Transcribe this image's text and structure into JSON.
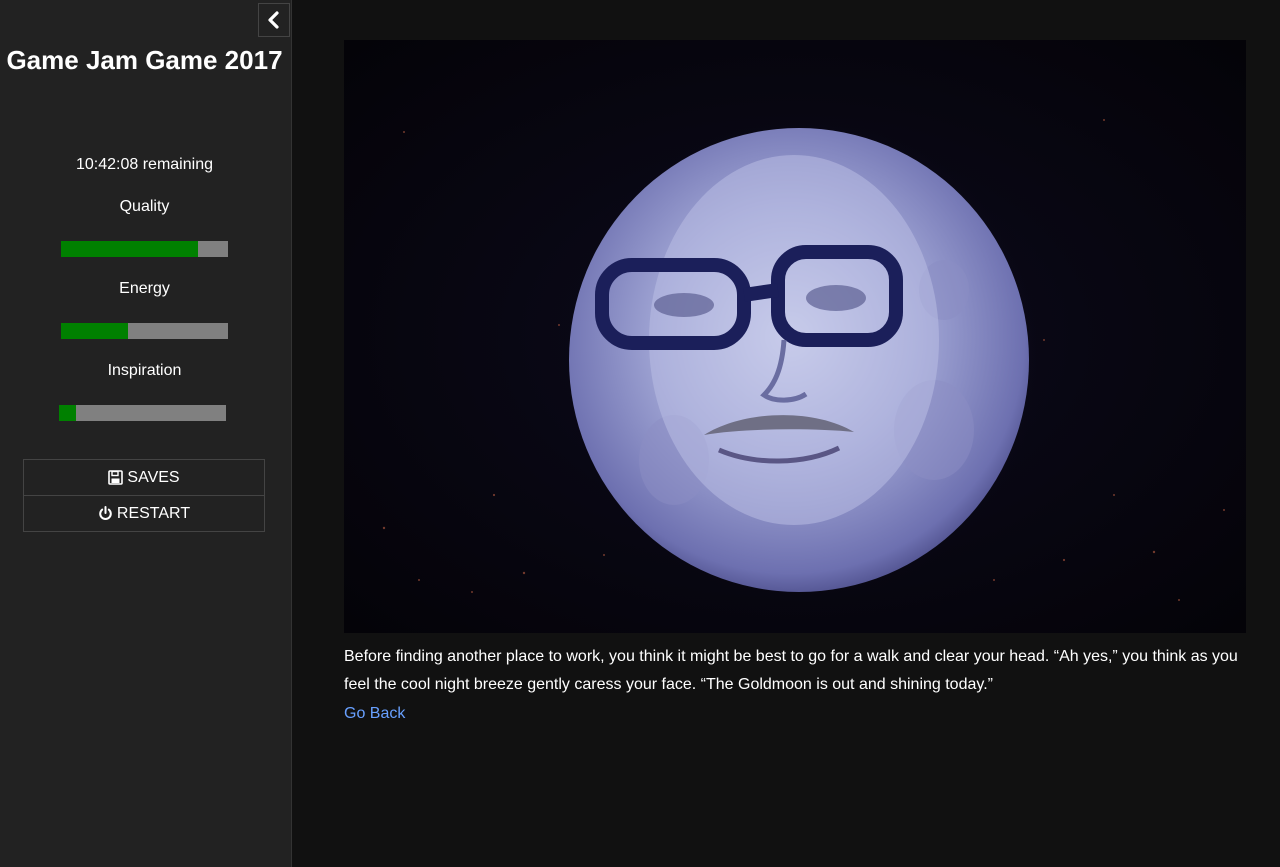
{
  "sidebar": {
    "toggle_icon": "chevron-left-icon",
    "title": "Game Jam Game 2017",
    "timer": "10:42:08 remaining",
    "stats": [
      {
        "label": "Quality",
        "value": 0.82
      },
      {
        "label": "Energy",
        "value": 0.4
      },
      {
        "label": "Inspiration",
        "value": 0.1
      }
    ],
    "menu": {
      "saves_label": "SAVES",
      "saves_icon": "floppy-disk-icon",
      "restart_label": "RESTART",
      "restart_icon": "power-icon"
    }
  },
  "passage": {
    "image_alt": "Goldmoon: a face in the full moon against a night sky",
    "text": "Before finding another place to work, you think it might be best to go for a walk and clear your head. “Ah yes,” you think as you feel the cool night breeze gently caress your face. “The Goldmoon is out and shining today.”",
    "link_label": "Go Back"
  },
  "colors": {
    "bar_fill": "#008000",
    "bar_track": "#808080",
    "link": "#68a0ff",
    "sidebar_bg": "#222222",
    "page_bg": "#111111"
  }
}
